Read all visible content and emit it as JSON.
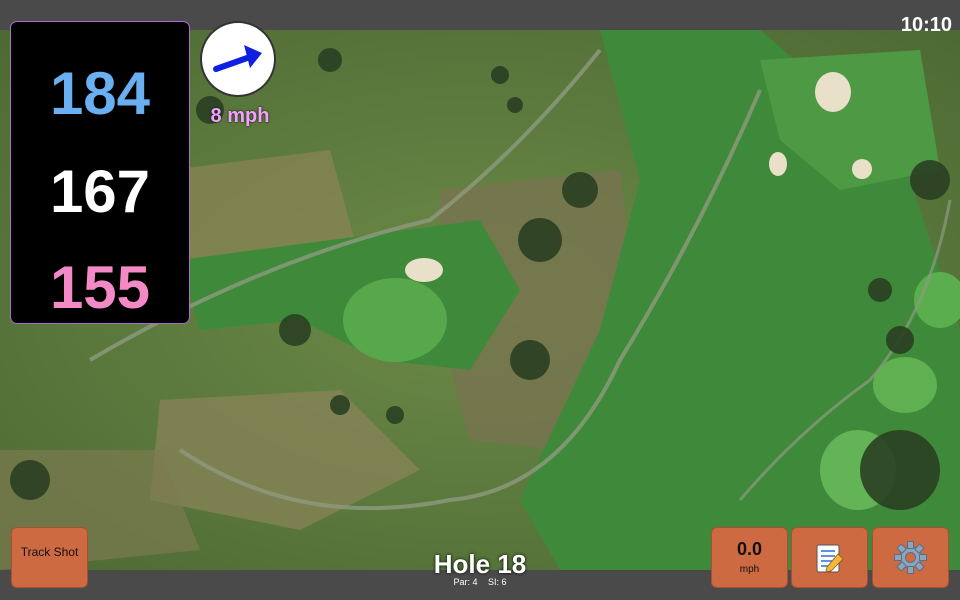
{
  "clock": "10:10",
  "distances": {
    "back": "184",
    "middle": "167",
    "front": "155"
  },
  "wind": {
    "speed_label": "8 mph",
    "direction": "east-north-east",
    "arrow_color": "#1020e0"
  },
  "buttons": {
    "track_shot": "Track Shot",
    "wind_value": "0.0",
    "wind_unit": "mph",
    "notes_icon": "notepad-icon",
    "settings_icon": "gear-icon"
  },
  "hole": {
    "title": "Hole 18",
    "par": "Par: 4",
    "si": "SI: 6"
  },
  "colors": {
    "back": "#6ab0f0",
    "middle": "#ffffff",
    "front": "#f38ac5",
    "button": "#cd6a42",
    "wind_text": "#f3a0ff"
  }
}
